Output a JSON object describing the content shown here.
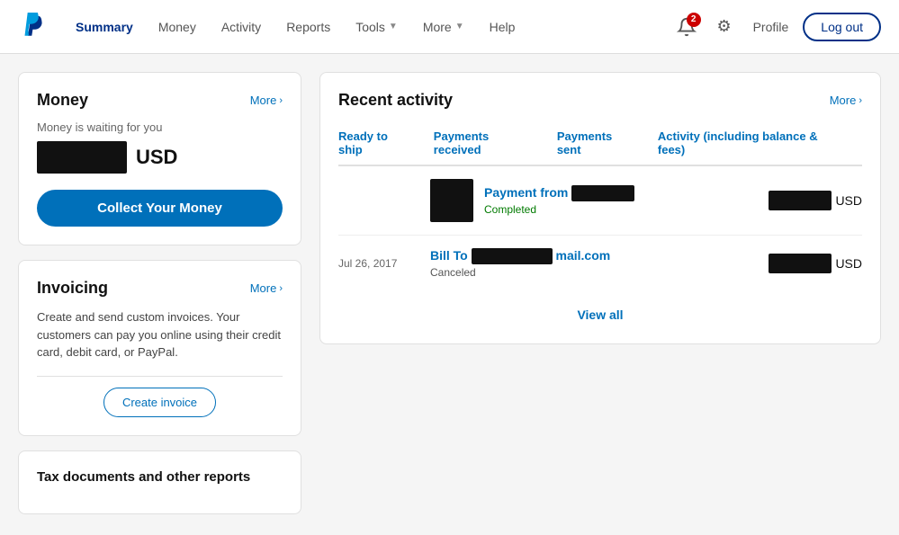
{
  "nav": {
    "logo_alt": "PayPal",
    "links": [
      {
        "label": "Summary",
        "active": true,
        "hasDropdown": false
      },
      {
        "label": "Money",
        "active": false,
        "hasDropdown": false
      },
      {
        "label": "Activity",
        "active": false,
        "hasDropdown": false
      },
      {
        "label": "Reports",
        "active": false,
        "hasDropdown": false
      },
      {
        "label": "Tools",
        "active": false,
        "hasDropdown": true
      },
      {
        "label": "More",
        "active": false,
        "hasDropdown": true
      },
      {
        "label": "Help",
        "active": false,
        "hasDropdown": false
      }
    ],
    "bell_badge": "2",
    "profile_label": "Profile",
    "logout_label": "Log out"
  },
  "money_card": {
    "title": "Money",
    "more_label": "More",
    "subtitle": "Money is waiting for you",
    "currency": "USD",
    "collect_btn": "Collect Your Money"
  },
  "invoicing_card": {
    "title": "Invoicing",
    "more_label": "More",
    "description": "Create and send custom invoices. Your customers can pay you online using their credit card, debit card, or PayPal.",
    "create_btn": "Create invoice"
  },
  "tax_card": {
    "title": "Tax documents and other reports"
  },
  "recent_activity": {
    "title": "Recent activity",
    "more_label": "More",
    "tabs": [
      {
        "label": "Ready to ship",
        "active": false
      },
      {
        "label": "Payments received",
        "active": false
      },
      {
        "label": "Payments sent",
        "active": false
      },
      {
        "label": "Activity (including balance & fees)",
        "active": false
      }
    ],
    "rows": [
      {
        "date": "",
        "type": "Payment from",
        "name_redacted": true,
        "email_suffix": "",
        "status": "Completed",
        "status_type": "completed",
        "amount_redacted": true,
        "currency": "USD"
      },
      {
        "date": "Jul 26, 2017",
        "type": "Bill To",
        "name_redacted": true,
        "email_suffix": "mail.com",
        "status": "Canceled",
        "status_type": "canceled",
        "amount_redacted": true,
        "currency": "USD"
      }
    ],
    "view_all_label": "View all"
  }
}
